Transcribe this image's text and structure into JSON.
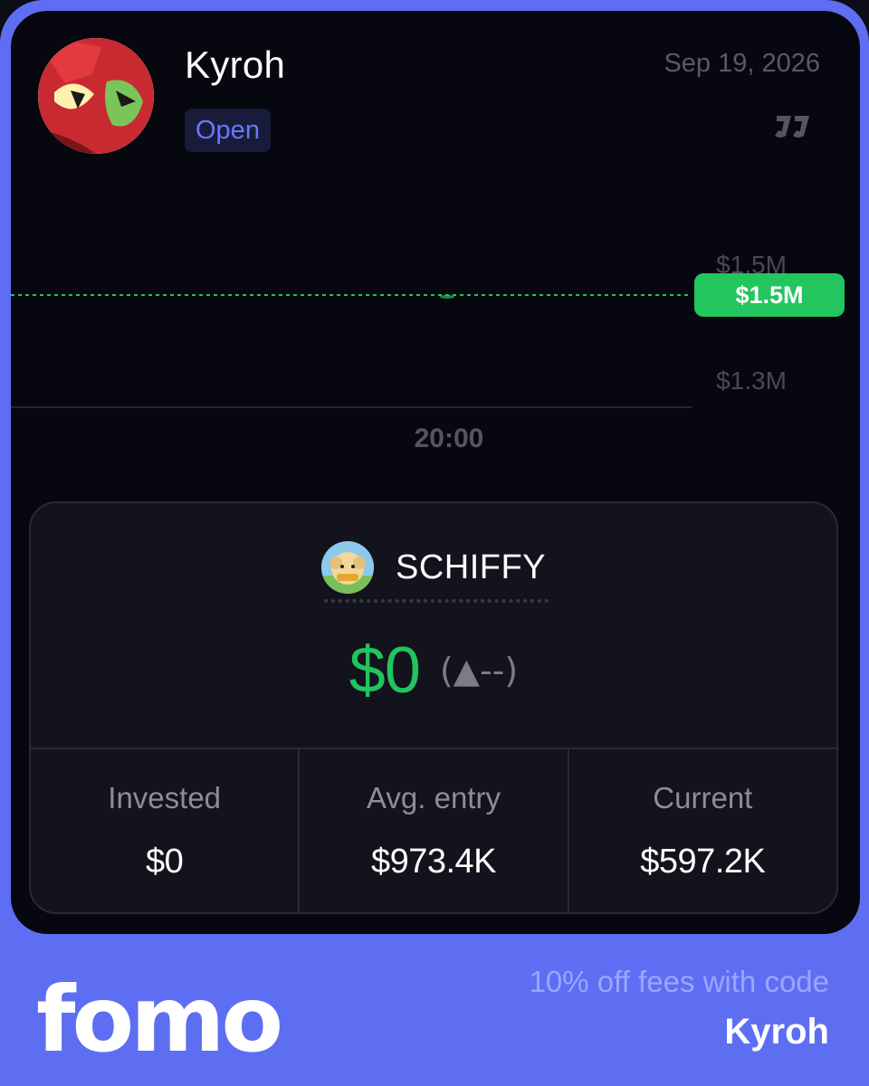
{
  "header": {
    "username": "Kyroh",
    "status": "Open",
    "date": "Sep 19, 2026"
  },
  "chart_data": {
    "type": "line",
    "title": "",
    "xlabel": "",
    "ylabel": "",
    "x_ticks": [
      "20:00"
    ],
    "y_ticks": [
      "$1.5M",
      "$1.3M"
    ],
    "current_price_label": "$1.5M",
    "current_price": 1.5,
    "series": [],
    "grid": false
  },
  "position": {
    "token": "SCHIFFY",
    "pnl": "$0",
    "pnl_change": "(▲--)",
    "metrics": [
      {
        "label": "Invested",
        "value": "$0"
      },
      {
        "label": "Avg. entry",
        "value": "$973.4K"
      },
      {
        "label": "Current",
        "value": "$597.2K"
      }
    ]
  },
  "footer": {
    "logo": "fomo",
    "promo_text": "10% off fees with code",
    "promo_code": "Kyroh"
  },
  "colors": {
    "accent": "#5d6ef2",
    "positive": "#21c45d",
    "badge_text": "#6878ff"
  },
  "icons": {
    "avatar": "avatar-icon",
    "brand_mark": "brand-logo-icon",
    "token": "token-icon"
  }
}
